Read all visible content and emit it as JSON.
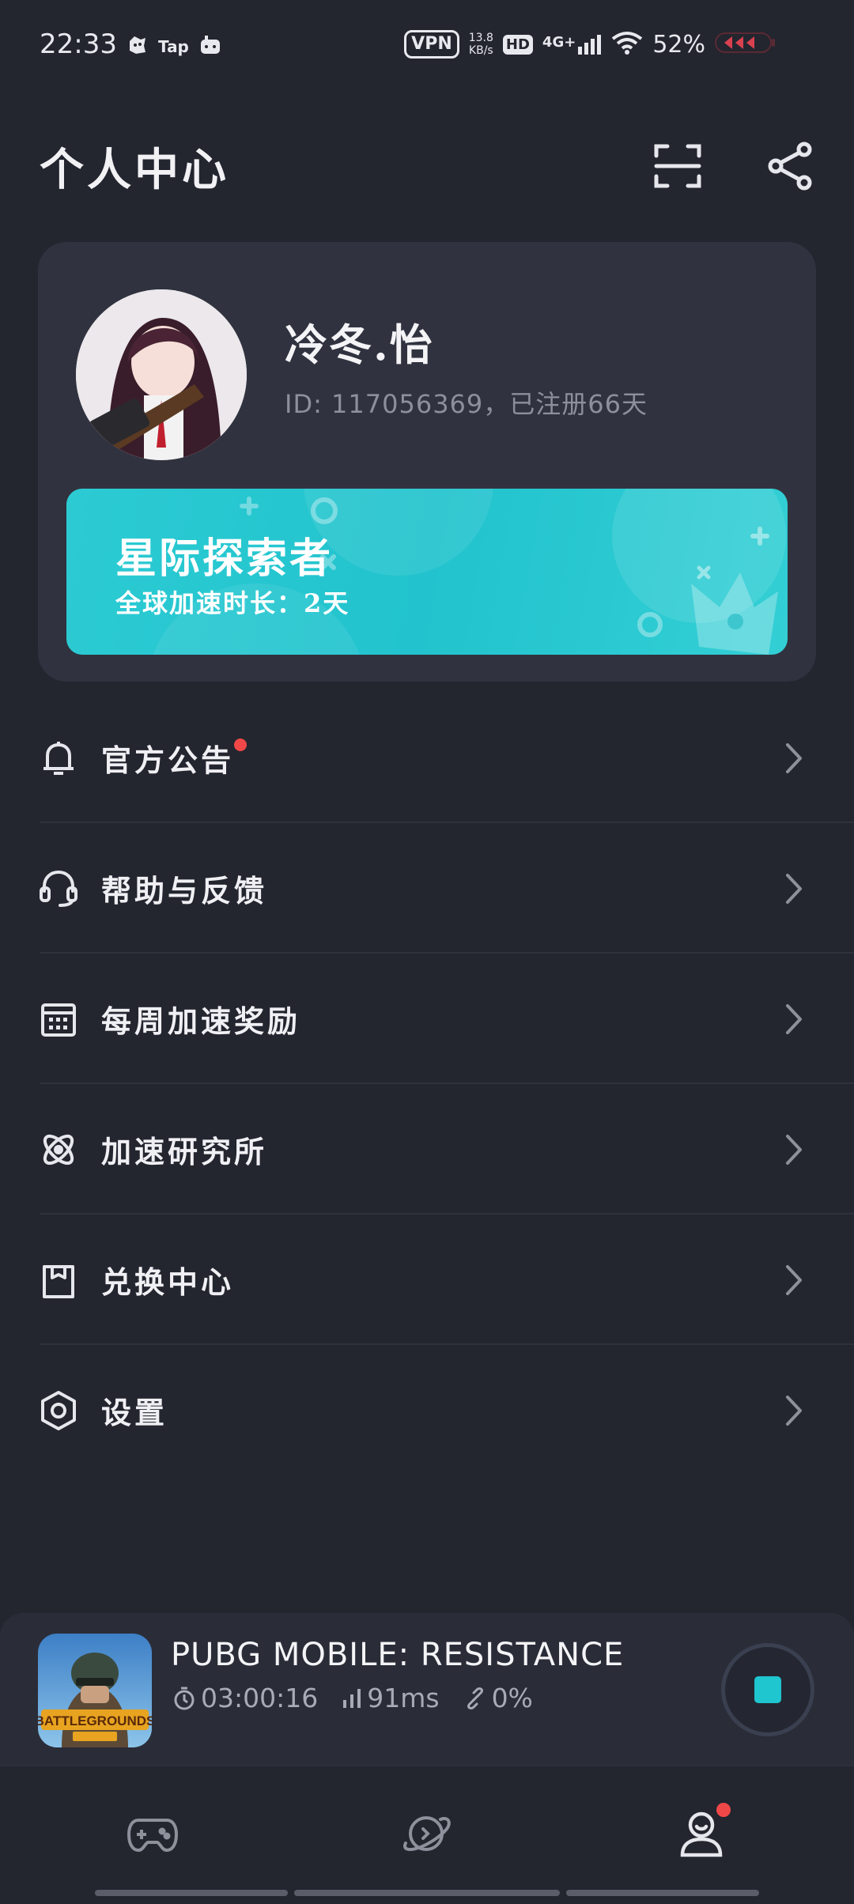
{
  "status_bar": {
    "time": "22:33",
    "app_icons": [
      "gamepad-app-icon",
      "tap-app-icon",
      "controller-app-icon"
    ],
    "tap_label": "Tap",
    "vpn": "VPN",
    "speed_value": "13.8",
    "speed_unit": "KB/s",
    "hd": "HD",
    "network": "4G+",
    "battery": "52%"
  },
  "header": {
    "title": "个人中心",
    "scan_icon": "scan-icon",
    "share_icon": "share-icon"
  },
  "profile": {
    "username": "冷冬.怡",
    "id_text": "ID: 117056369，已注册66天",
    "vip_title": "星际探索者",
    "vip_subtitle": "全球加速时长：2天"
  },
  "menu": {
    "items": [
      {
        "label": "官方公告",
        "icon": "bell-icon",
        "has_dot": true
      },
      {
        "label": "帮助与反馈",
        "icon": "headset-icon",
        "has_dot": false
      },
      {
        "label": "每周加速奖励",
        "icon": "calendar-icon",
        "has_dot": false
      },
      {
        "label": "加速研究所",
        "icon": "atom-icon",
        "has_dot": false
      },
      {
        "label": "兑换中心",
        "icon": "shopping-bag-icon",
        "has_dot": false
      },
      {
        "label": "设置",
        "icon": "settings-icon",
        "has_dot": false
      }
    ]
  },
  "game_bar": {
    "title": "PUBG MOBILE: RESISTANCE",
    "duration": "03:00:16",
    "latency": "91ms",
    "packet_loss": "0%"
  },
  "bottom_nav": {
    "items": [
      "games-icon",
      "explore-icon",
      "profile-icon"
    ],
    "active": "profile-icon"
  },
  "colors": {
    "background": "#23252f",
    "card": "#30333f",
    "accent": "#22c3ce",
    "badge_red": "#f04848"
  }
}
